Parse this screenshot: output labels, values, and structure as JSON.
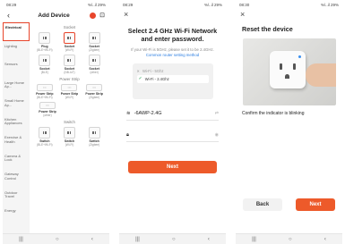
{
  "screen1": {
    "status_time": "08:29",
    "status_icons": "%\\..il 29%",
    "back_icon": "‹",
    "title": "Add Device",
    "categories": [
      "Electrical",
      "Lighting",
      "Sensors",
      "Large Home Ap...",
      "Small Home Ap...",
      "Kitchen Appliances",
      "Exercise & Health",
      "Camera & Lock",
      "Gateway Control",
      "Outdoor Travel",
      "Energy"
    ],
    "section_socket": "Socket",
    "row1": [
      {
        "name": "Plug",
        "sub": "(BLE+Wi-Fi)"
      },
      {
        "name": "Socket",
        "sub": "(Wi-Fi)"
      },
      {
        "name": "Socket",
        "sub": "(Zigbee)"
      }
    ],
    "row2": [
      {
        "name": "Socket",
        "sub": "(BLE)"
      },
      {
        "name": "Socket",
        "sub": "(NB-IoT)"
      },
      {
        "name": "Socket",
        "sub": "(other)"
      }
    ],
    "section_strip": "Power Strip",
    "row3": [
      {
        "name": "Power Strip",
        "sub": "(BLE+Wi-Fi)"
      },
      {
        "name": "Power Strip",
        "sub": "(Wi-Fi)"
      },
      {
        "name": "Power Strip",
        "sub": "(Zigbee)"
      }
    ],
    "row4": [
      {
        "name": "Power Strip",
        "sub": "(other)"
      }
    ],
    "section_switch": "Switch",
    "row5": [
      {
        "name": "Switch",
        "sub": "(BLE+Wi-Fi)"
      },
      {
        "name": "Switch",
        "sub": "(Wi-Fi)"
      },
      {
        "name": "Switch",
        "sub": "(Zigbee)"
      }
    ]
  },
  "screen2": {
    "status_time": "08:29",
    "status_icons": "%\\..il 29%",
    "close_icon": "×",
    "title_line1": "Select 2.4 GHz Wi-Fi Network",
    "title_line2": "and enter password.",
    "note": "If your Wi-Fi is 5GHz, please set it to be 2.4GHz.",
    "note_link": "Common router setting method",
    "wifi_5g": "Wi-Fi - 5Ghz",
    "wifi_24g": "Wi-Fi - 2.4Ghz",
    "ssid": "-6AWP-2.4G",
    "password": "",
    "next_label": "Next"
  },
  "screen3": {
    "status_time": "08:30",
    "status_icons": "%\\..il 29%",
    "close_icon": "×",
    "title": "Reset the device",
    "confirm": "Confirm the indicator is blinking",
    "back_label": "Back",
    "next_label": "Next"
  },
  "nav": {
    "recent": "|||",
    "home": "○",
    "back": "‹"
  },
  "colors": {
    "accent": "#ed5a2a",
    "highlight_border": "#e8452b",
    "link": "#2a7de1"
  }
}
